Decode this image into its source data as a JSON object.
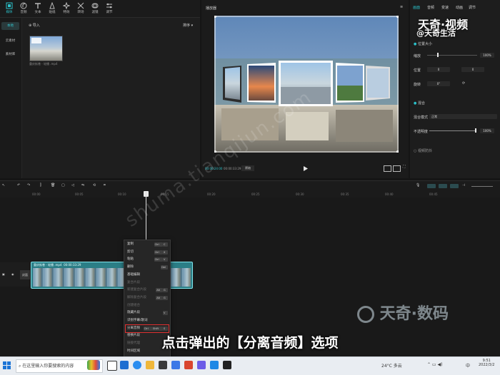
{
  "toolbar": {
    "tools": [
      {
        "label": "媒体",
        "icon": "media-icon"
      },
      {
        "label": "音频",
        "icon": "audio-icon"
      },
      {
        "label": "文本",
        "icon": "text-icon"
      },
      {
        "label": "贴纸",
        "icon": "sticker-icon"
      },
      {
        "label": "特效",
        "icon": "effects-icon"
      },
      {
        "label": "转场",
        "icon": "transition-icon"
      },
      {
        "label": "滤镜",
        "icon": "filter-icon"
      },
      {
        "label": "调节",
        "icon": "adjust-icon"
      }
    ]
  },
  "left_nav": {
    "items": [
      "本地",
      "云素材",
      "素材库"
    ]
  },
  "media": {
    "import_label": "导入",
    "sort_label": "排序",
    "thumb_name": "重庆街巷 - 轮播 .mp4"
  },
  "player": {
    "title": "播放器",
    "time_current": "00:00:24:00",
    "time_total": "00:00:33:29",
    "ratio_label": "原始"
  },
  "properties": {
    "tabs": [
      "画面",
      "音频",
      "变速",
      "动画",
      "调节"
    ],
    "position_size_label": "位置大小",
    "scale_label": "缩放",
    "scale_value": "100%",
    "position_label": "位置",
    "pos_x": "0",
    "pos_y": "0",
    "rotate_label": "旋转",
    "rotate_value": "0°",
    "blend_label": "混合",
    "blend_mode_label": "混合模式",
    "blend_mode_value": "正常",
    "opacity_label": "不透明度",
    "opacity_value": "100%",
    "video_anti_shake": "视频防抖"
  },
  "timeline": {
    "ticks": [
      "00:00",
      "00:05",
      "00:10",
      "00:15",
      "00:20",
      "00:25",
      "00:30",
      "00:35",
      "00:40",
      "00:45"
    ],
    "track_label": "封面",
    "clip_title": "重庆街巷 - 轮播 .mp4",
    "clip_duration": "00:00:33:29"
  },
  "context_menu": {
    "items": [
      {
        "label": "复制",
        "kbd": [
          "Ctrl",
          "C"
        ],
        "disabled": false
      },
      {
        "label": "剪切",
        "kbd": [
          "Ctrl",
          "X"
        ],
        "disabled": false
      },
      {
        "label": "粘贴",
        "kbd": [
          "Ctrl",
          "V"
        ],
        "disabled": false
      },
      {
        "label": "删除",
        "kbd": [
          "Del"
        ],
        "disabled": false
      },
      {
        "label": "基础编辑",
        "kbd": [],
        "disabled": false
      },
      {
        "label": "复合片段",
        "kbd": [],
        "disabled": true
      },
      {
        "label": "新建复合片段",
        "kbd": [
          "Alt",
          "G"
        ],
        "disabled": true
      },
      {
        "label": "解除复合片段",
        "kbd": [
          "Alt",
          "G"
        ],
        "disabled": true
      },
      {
        "label": "创建组合",
        "kbd": [],
        "disabled": true
      },
      {
        "label": "隐藏片段",
        "kbd": [
          "V"
        ],
        "disabled": false
      },
      {
        "label": "识别字幕/歌词",
        "kbd": [],
        "disabled": false
      },
      {
        "label": "分离音频",
        "kbd": [
          "Ctrl",
          "Shift",
          "S"
        ],
        "disabled": false
      },
      {
        "label": "替换片段",
        "kbd": [],
        "disabled": false
      },
      {
        "label": "链接代理",
        "kbd": [],
        "disabled": true
      },
      {
        "label": "时间区域",
        "kbd": [],
        "disabled": false
      }
    ]
  },
  "overlays": {
    "caption": "点击弹出的【分离音频】选项",
    "brand_top_line1": "天奇·视频",
    "brand_top_line2": "@天奇生活",
    "brand_mid": "天奇·数码",
    "diag_watermark": "shuma.tianqijun.com"
  },
  "taskbar": {
    "search_placeholder": "在这里输入你要搜索的内容",
    "weather": "24°C 多云",
    "ime": "中",
    "time": "9:51",
    "date": "2022/3/2"
  },
  "colors": {
    "accent": "#2bc0c9",
    "highlight": "#e03030",
    "clip": "#2b7e86"
  }
}
